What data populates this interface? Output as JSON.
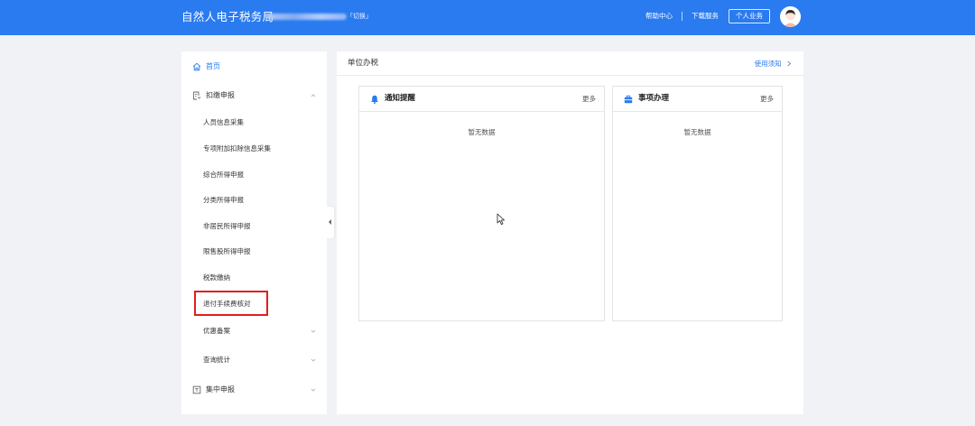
{
  "header": {
    "title": "自然人电子税务局",
    "switch_label": "「切换」",
    "links": {
      "help": "帮助中心",
      "download": "下载服务"
    },
    "personal_button": "个人业务"
  },
  "sidebar": {
    "home": "首页",
    "withholding": {
      "label": "扣缴申报",
      "expanded": true,
      "children": [
        "人员信息采集",
        "专项附加扣除信息采集",
        "综合所得申报",
        "分类所得申报",
        "非居民所得申报",
        "限售股所得申报",
        "税款缴纳",
        "退付手续费核对",
        "优惠备案",
        "查询统计"
      ]
    },
    "centralized": "集中申报"
  },
  "main": {
    "title": "单位办税",
    "guide_link": "使用须知",
    "cards": {
      "notice": {
        "title": "通知提醒",
        "more": "更多",
        "empty": "暂无数据"
      },
      "affairs": {
        "title": "事项办理",
        "more": "更多",
        "empty": "暂无数据"
      }
    }
  },
  "colors": {
    "brand": "#2a7bf0",
    "highlight": "#e01e1e",
    "background": "#f0f2f5"
  },
  "icons": {
    "home": "home-icon",
    "withholding": "document-icon",
    "centralized": "archive-icon",
    "notice": "bell-icon",
    "affairs": "briefcase-icon"
  }
}
